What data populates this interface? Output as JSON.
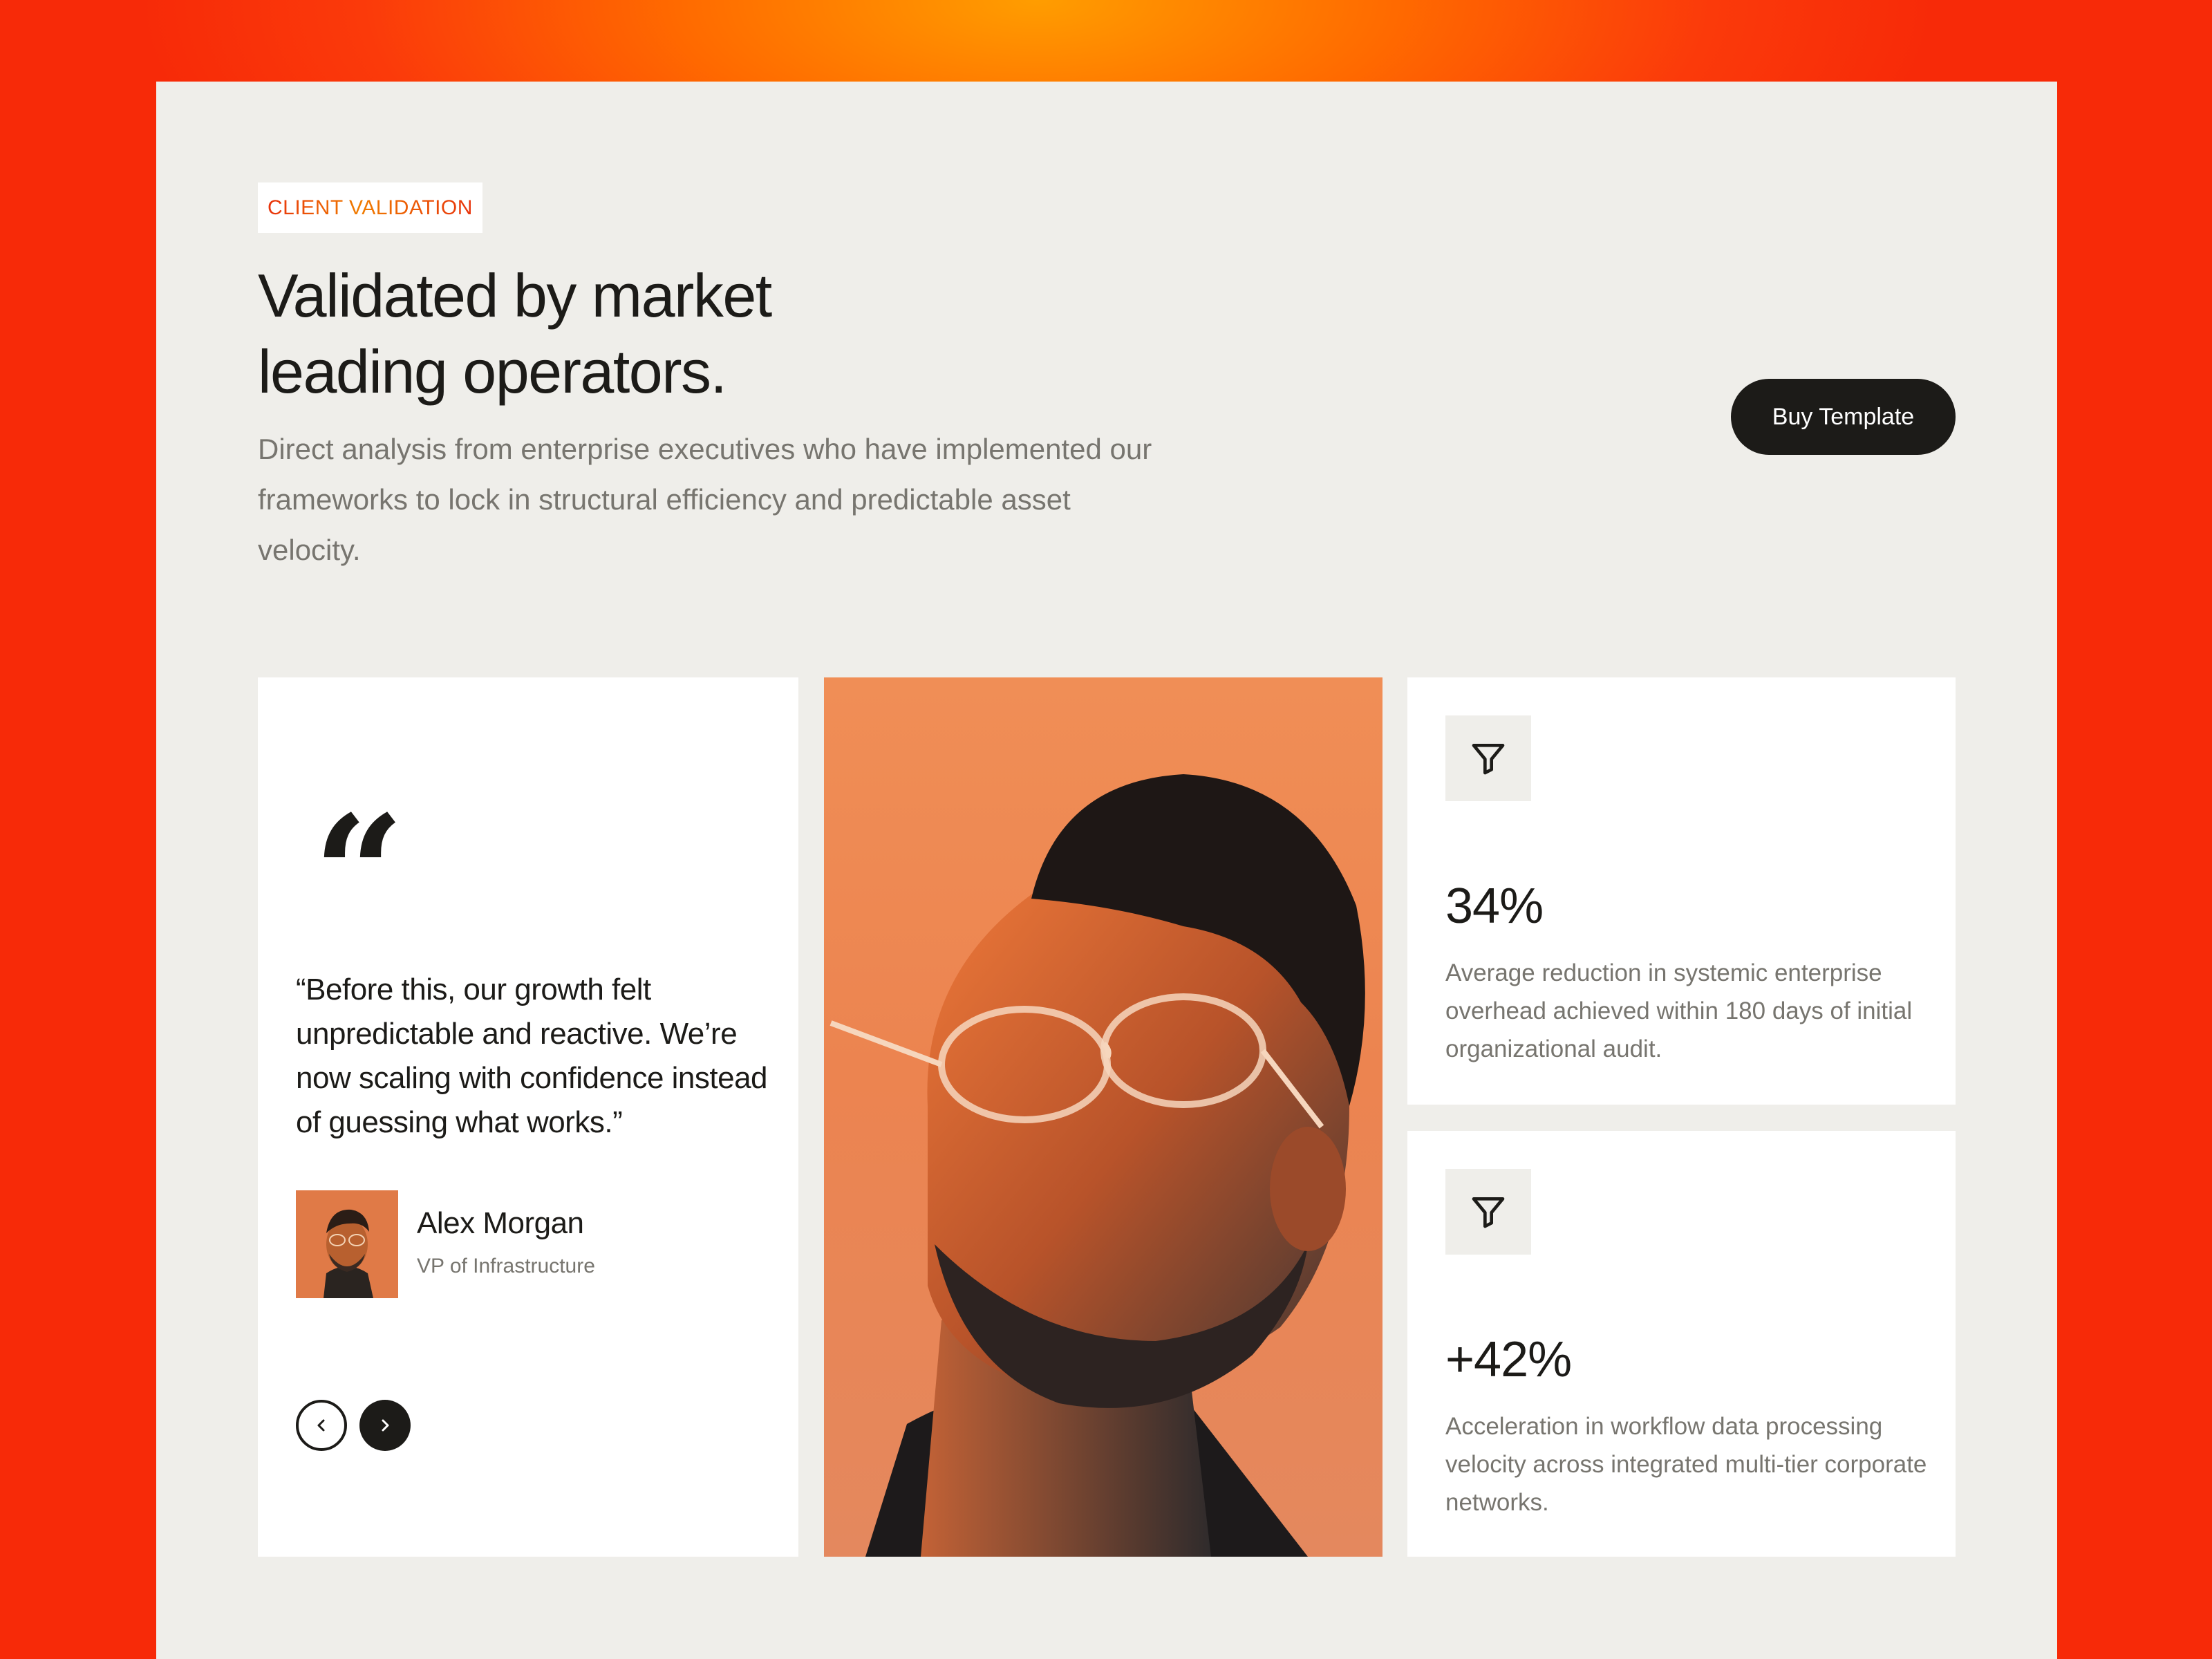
{
  "section": {
    "eyebrow": "CLIENT VALIDATION",
    "headline_line1": "Validated by market",
    "headline_line2": "leading operators.",
    "subtext": "Direct analysis from enterprise executives who have implemented our frameworks to lock in structural efficiency and predictable asset velocity.",
    "cta_label": "Buy Template"
  },
  "testimonial": {
    "quote_glyph": "“",
    "quote": "“Before this, our growth felt unpredictable and reactive. We’re now scaling with confidence instead of guessing what works.”",
    "author_name": "Alex Morgan",
    "author_role": "VP of Infrastructure"
  },
  "stats": [
    {
      "icon": "filter-icon",
      "value": "34%",
      "description": "Average reduction in systemic enterprise overhead achieved within 180 days of initial organizational audit."
    },
    {
      "icon": "filter-icon",
      "value": "+42%",
      "description": "Acceleration in workflow data processing velocity across integrated multi-tier corporate networks."
    }
  ],
  "colors": {
    "accent_orange": "#ff9d00",
    "accent_red": "#f72a08",
    "panel_bg": "#efeeea",
    "dark": "#1c1b18",
    "muted_text": "#77756f"
  }
}
